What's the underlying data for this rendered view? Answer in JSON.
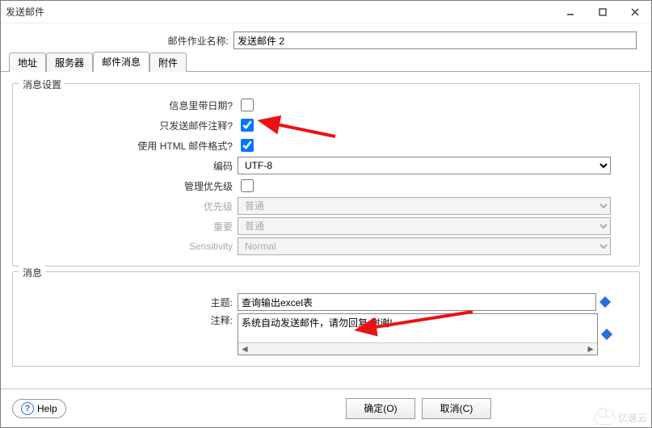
{
  "window": {
    "title": "发送邮件",
    "minimize_tip": "最小化",
    "maximize_tip": "最大化",
    "close_tip": "关闭"
  },
  "jobname": {
    "label": "邮件作业名称:",
    "value": "发送邮件 2"
  },
  "tabs": {
    "addr": "地址",
    "server": "服务器",
    "message": "邮件消息",
    "attach": "附件"
  },
  "settings": {
    "legend": "消息设置",
    "include_date_label": "信息里带日期?",
    "include_date": false,
    "only_comment_label": "只发送邮件注释?",
    "only_comment": true,
    "html_format_label": "使用 HTML 邮件格式?",
    "html_format": true,
    "encoding_label": "编码",
    "encoding_value": "UTF-8",
    "manage_priority_label": "管理优先级",
    "manage_priority": false,
    "priority_label": "优先级",
    "priority_value": "普通",
    "importance_label": "重要",
    "importance_value": "普通",
    "sensitivity_label": "Sensitivity",
    "sensitivity_value": "Normal"
  },
  "messagebox": {
    "legend": "消息",
    "subject_label": "主题:",
    "subject_value": "查询输出excel表",
    "comment_label": "注释:",
    "comment_value": "系统自动发送邮件，请勿回复,谢谢!"
  },
  "footer": {
    "help": "Help",
    "ok": "确定(O)",
    "cancel": "取消(C)"
  },
  "watermark": "亿速云"
}
